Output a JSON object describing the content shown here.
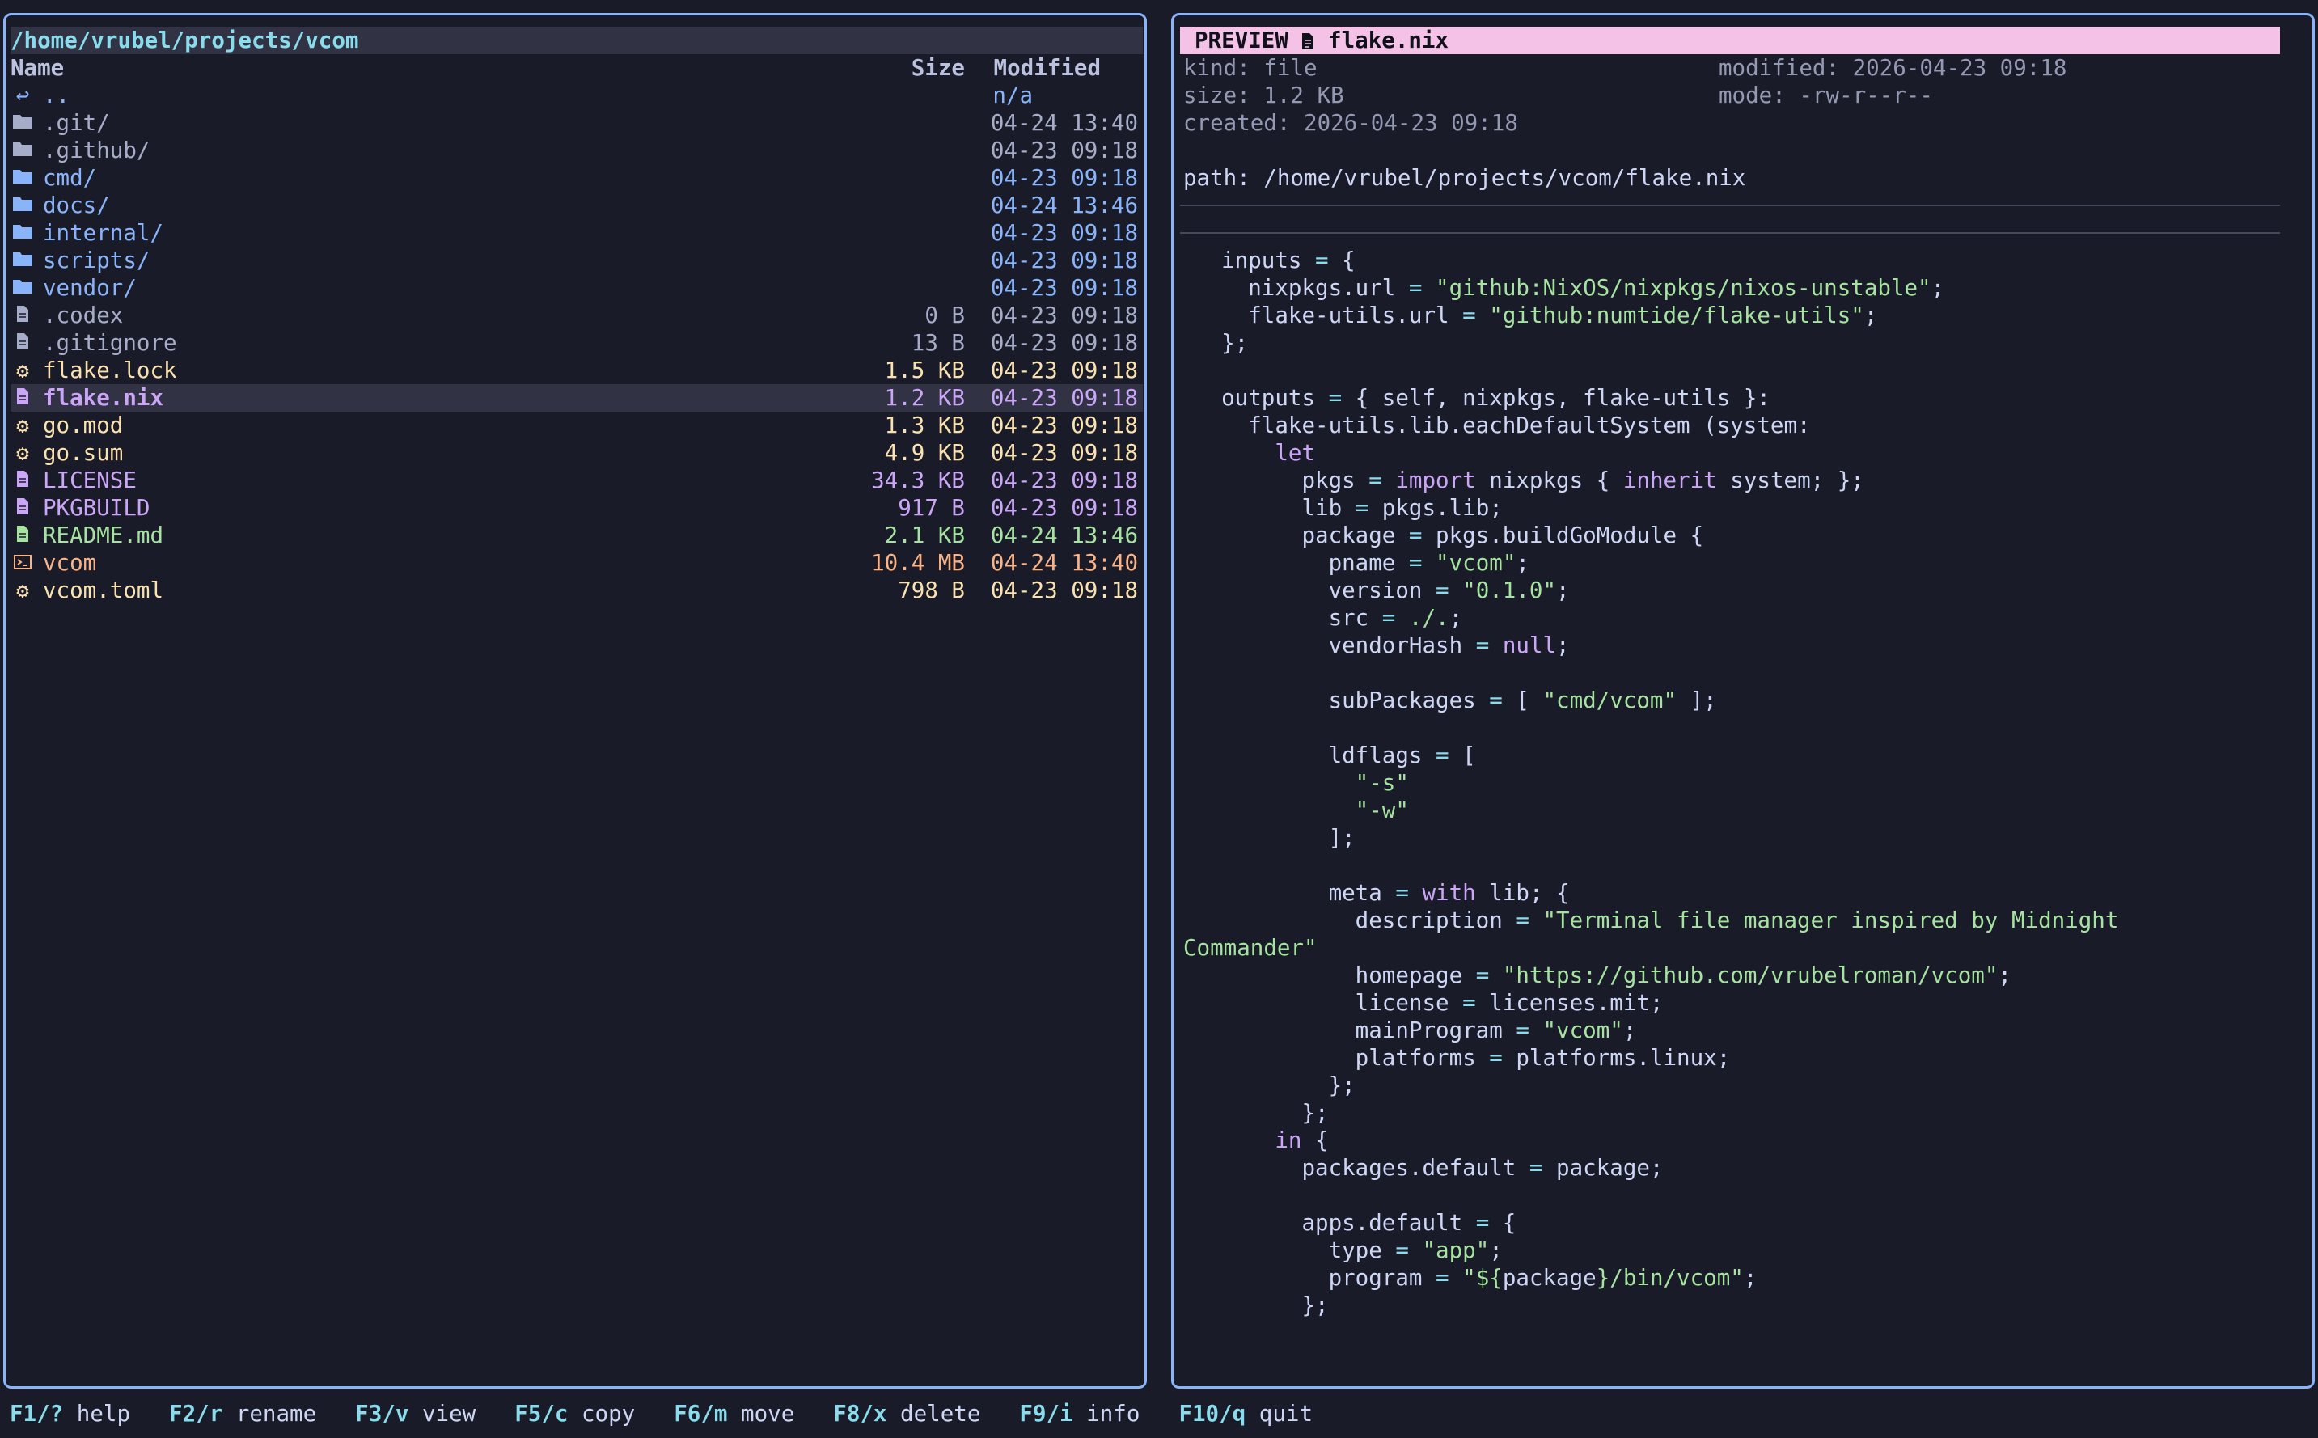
{
  "left_panel": {
    "path": "/home/vrubel/projects/vcom",
    "columns": {
      "name": "Name",
      "size": "Size",
      "modified": "Modified"
    },
    "entries": [
      {
        "icon": "up-arrow-icon",
        "name": "..",
        "size": "",
        "modified": "n/a",
        "color": "up"
      },
      {
        "icon": "folder-icon",
        "name": ".git/",
        "size": "",
        "modified": "04-24 13:40",
        "color": "hidden"
      },
      {
        "icon": "folder-icon",
        "name": ".github/",
        "size": "",
        "modified": "04-23 09:18",
        "color": "hidden"
      },
      {
        "icon": "folder-icon",
        "name": "cmd/",
        "size": "",
        "modified": "04-23 09:18",
        "color": "dir"
      },
      {
        "icon": "folder-icon",
        "name": "docs/",
        "size": "",
        "modified": "04-24 13:46",
        "color": "dir"
      },
      {
        "icon": "folder-icon",
        "name": "internal/",
        "size": "",
        "modified": "04-23 09:18",
        "color": "dir"
      },
      {
        "icon": "folder-icon",
        "name": "scripts/",
        "size": "",
        "modified": "04-23 09:18",
        "color": "dir"
      },
      {
        "icon": "folder-icon",
        "name": "vendor/",
        "size": "",
        "modified": "04-23 09:18",
        "color": "dir"
      },
      {
        "icon": "file-icon",
        "name": ".codex",
        "size": "0 B",
        "modified": "04-23 09:18",
        "color": "hidden"
      },
      {
        "icon": "file-icon",
        "name": ".gitignore",
        "size": "13 B",
        "modified": "04-23 09:18",
        "color": "hidden"
      },
      {
        "icon": "gear-icon",
        "name": "flake.lock",
        "size": "1.5 KB",
        "modified": "04-23 09:18",
        "color": "config"
      },
      {
        "icon": "file-icon",
        "name": "flake.nix",
        "size": "1.2 KB",
        "modified": "04-23 09:18",
        "color": "nix",
        "selected": true
      },
      {
        "icon": "gear-icon",
        "name": "go.mod",
        "size": "1.3 KB",
        "modified": "04-23 09:18",
        "color": "config"
      },
      {
        "icon": "gear-icon",
        "name": "go.sum",
        "size": "4.9 KB",
        "modified": "04-23 09:18",
        "color": "config"
      },
      {
        "icon": "file-icon",
        "name": "LICENSE",
        "size": "34.3 KB",
        "modified": "04-23 09:18",
        "color": "nix"
      },
      {
        "icon": "file-icon",
        "name": "PKGBUILD",
        "size": "917 B",
        "modified": "04-23 09:18",
        "color": "nix"
      },
      {
        "icon": "file-icon",
        "name": "README.md",
        "size": "2.1 KB",
        "modified": "04-24 13:46",
        "color": "doc"
      },
      {
        "icon": "terminal-icon",
        "name": "vcom",
        "size": "10.4 MB",
        "modified": "04-24 13:40",
        "color": "exec"
      },
      {
        "icon": "gear-icon",
        "name": "vcom.toml",
        "size": "798 B",
        "modified": "04-23 09:18",
        "color": "config"
      }
    ]
  },
  "preview": {
    "label": "PREVIEW",
    "filename": "flake.nix",
    "kind": "kind: file",
    "size": "size: 1.2 KB",
    "created": "created: 2026-04-23 09:18",
    "modified": "modified: 2026-04-23 09:18",
    "mode": "mode: -rw-r--r--",
    "path": "path: /home/vrubel/projects/vcom/flake.nix",
    "code": [
      [
        [
          "",
          "  inputs "
        ],
        [
          "op",
          "="
        ],
        [
          "",
          " {"
        ]
      ],
      [
        [
          "",
          "    nixpkgs.url "
        ],
        [
          "op",
          "="
        ],
        [
          "",
          " "
        ],
        [
          "str",
          "\"github:NixOS/nixpkgs/nixos-unstable\""
        ],
        [
          "",
          ";"
        ]
      ],
      [
        [
          "",
          "    flake-utils.url "
        ],
        [
          "op",
          "="
        ],
        [
          "",
          " "
        ],
        [
          "str",
          "\"github:numtide/flake-utils\""
        ],
        [
          "",
          ";"
        ]
      ],
      [
        [
          "",
          "  };"
        ]
      ],
      [
        [
          "",
          ""
        ]
      ],
      [
        [
          "",
          "  outputs "
        ],
        [
          "op",
          "="
        ],
        [
          "",
          " { self, nixpkgs, flake-utils }:"
        ]
      ],
      [
        [
          "",
          "    flake-utils.lib.eachDefaultSystem (system:"
        ]
      ],
      [
        [
          "kw",
          "      let"
        ]
      ],
      [
        [
          "",
          "        pkgs "
        ],
        [
          "op",
          "="
        ],
        [
          "",
          " "
        ],
        [
          "kw",
          "import"
        ],
        [
          "",
          " nixpkgs { "
        ],
        [
          "kw",
          "inherit"
        ],
        [
          "",
          " system; };"
        ]
      ],
      [
        [
          "",
          "        lib "
        ],
        [
          "op",
          "="
        ],
        [
          "",
          " pkgs.lib;"
        ]
      ],
      [
        [
          "",
          "        package "
        ],
        [
          "op",
          "="
        ],
        [
          "",
          " pkgs.buildGoModule {"
        ]
      ],
      [
        [
          "",
          "          pname "
        ],
        [
          "op",
          "="
        ],
        [
          "",
          " "
        ],
        [
          "str",
          "\"vcom\""
        ],
        [
          "",
          ";"
        ]
      ],
      [
        [
          "",
          "          version "
        ],
        [
          "op",
          "="
        ],
        [
          "",
          " "
        ],
        [
          "str",
          "\"0.1.0\""
        ],
        [
          "",
          ";"
        ]
      ],
      [
        [
          "",
          "          src "
        ],
        [
          "op",
          "="
        ],
        [
          "",
          " "
        ],
        [
          "path",
          "./."
        ],
        [
          "",
          ";"
        ]
      ],
      [
        [
          "",
          "          vendorHash "
        ],
        [
          "op",
          "="
        ],
        [
          "",
          " "
        ],
        [
          "kw",
          "null"
        ],
        [
          "",
          ";"
        ]
      ],
      [
        [
          "",
          ""
        ]
      ],
      [
        [
          "",
          "          subPackages "
        ],
        [
          "op",
          "="
        ],
        [
          "",
          " [ "
        ],
        [
          "str",
          "\"cmd/vcom\""
        ],
        [
          "",
          " ];"
        ]
      ],
      [
        [
          "",
          ""
        ]
      ],
      [
        [
          "",
          "          ldflags "
        ],
        [
          "op",
          "="
        ],
        [
          "",
          " ["
        ]
      ],
      [
        [
          "str",
          "            \"-s\""
        ]
      ],
      [
        [
          "str",
          "            \"-w\""
        ]
      ],
      [
        [
          "",
          "          ];"
        ]
      ],
      [
        [
          "",
          ""
        ]
      ],
      [
        [
          "",
          "          meta "
        ],
        [
          "op",
          "="
        ],
        [
          "",
          " "
        ],
        [
          "kw",
          "with"
        ],
        [
          "",
          " lib; {"
        ]
      ],
      [
        [
          "",
          "            description "
        ],
        [
          "op",
          "="
        ],
        [
          "",
          " "
        ],
        [
          "str",
          "\"Terminal file manager inspired by Midnight"
        ]
      ],
      [
        [
          "str",
          "Commander\""
        ]
      ],
      [
        [
          "",
          "            homepage "
        ],
        [
          "op",
          "="
        ],
        [
          "",
          " "
        ],
        [
          "str",
          "\"https://github.com/vrubelroman/vcom\""
        ],
        [
          "",
          ";"
        ]
      ],
      [
        [
          "",
          "            license "
        ],
        [
          "op",
          "="
        ],
        [
          "",
          " licenses.mit;"
        ]
      ],
      [
        [
          "",
          "            mainProgram "
        ],
        [
          "op",
          "="
        ],
        [
          "",
          " "
        ],
        [
          "str",
          "\"vcom\""
        ],
        [
          "",
          ";"
        ]
      ],
      [
        [
          "",
          "            platforms "
        ],
        [
          "op",
          "="
        ],
        [
          "",
          " platforms.linux;"
        ]
      ],
      [
        [
          "",
          "          };"
        ]
      ],
      [
        [
          "",
          "        };"
        ]
      ],
      [
        [
          "kw",
          "      in"
        ],
        [
          "",
          " {"
        ]
      ],
      [
        [
          "",
          "        packages.default "
        ],
        [
          "op",
          "="
        ],
        [
          "",
          " package;"
        ]
      ],
      [
        [
          "",
          ""
        ]
      ],
      [
        [
          "",
          "        apps.default "
        ],
        [
          "op",
          "="
        ],
        [
          "",
          " {"
        ]
      ],
      [
        [
          "",
          "          type "
        ],
        [
          "op",
          "="
        ],
        [
          "",
          " "
        ],
        [
          "str",
          "\"app\""
        ],
        [
          "",
          ";"
        ]
      ],
      [
        [
          "",
          "          program "
        ],
        [
          "op",
          "="
        ],
        [
          "",
          " "
        ],
        [
          "str",
          "\"${"
        ],
        [
          "",
          "package"
        ],
        [
          "str",
          "}/bin/vcom\""
        ],
        [
          "",
          ";"
        ]
      ],
      [
        [
          "",
          "        };"
        ]
      ]
    ]
  },
  "footer": [
    {
      "key": "F1/?",
      "label": "help"
    },
    {
      "key": "F2/r",
      "label": "rename"
    },
    {
      "key": "F3/v",
      "label": "view"
    },
    {
      "key": "F5/c",
      "label": "copy"
    },
    {
      "key": "F6/m",
      "label": "move"
    },
    {
      "key": "F8/x",
      "label": "delete"
    },
    {
      "key": "F9/i",
      "label": "info"
    },
    {
      "key": "F10/q",
      "label": "quit"
    }
  ],
  "colors": {
    "background": "#1a1b28",
    "border": "#89b4fa",
    "preview_title_bg": "#f5c2e7",
    "selection_bg": "#313244"
  }
}
